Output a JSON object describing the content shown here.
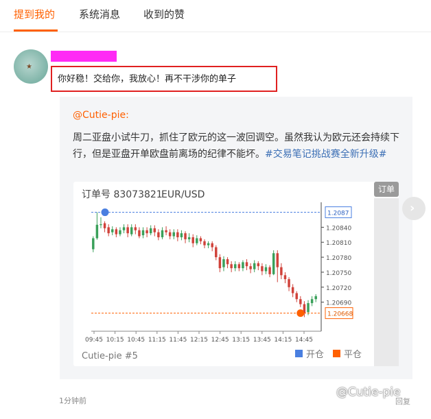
{
  "tabs": [
    {
      "label": "提到我的",
      "active": true
    },
    {
      "label": "系统消息",
      "active": false
    },
    {
      "label": "收到的赞",
      "active": false
    }
  ],
  "comment": {
    "text": "你好稳！交给你，我放心！再不干涉你的单子",
    "time": "1分钟前",
    "reply": "回复"
  },
  "quoted_post": {
    "mention": "@Cutie-pie:",
    "body": "周二亚盘小试牛刀，抓住了欧元的这一波回调空。虽然我认为欧元还会持续下行，但是亚盘开单欧盘前离场的纪律不能坏。",
    "hashtag": "#交易笔记挑战赛全新升级#"
  },
  "order_card": {
    "order_tag": "订单",
    "order_label": "订单号 83073821",
    "symbol": "EUR/USD",
    "author": "Cutie-pie #5",
    "legend_open": "开仓",
    "legend_close": "平仓",
    "open_color": "#4a7fe0",
    "close_color": "#ff6000"
  },
  "watermark": "@Cutie-pie",
  "chart_data": {
    "type": "candlestick",
    "x_ticks": [
      "09:45",
      "10:15",
      "10:45",
      "11:15",
      "11:45",
      "12:15",
      "12:45",
      "13:15",
      "13:45",
      "14:15",
      "14:45"
    ],
    "y_ticks": [
      "1.20840",
      "1.20810",
      "1.20780",
      "1.20750",
      "1.20720",
      "1.20690"
    ],
    "ylim": [
      1.2064,
      1.2089
    ],
    "open_price": "1.2087",
    "close_price": "1.20668",
    "open_level": 1.2087,
    "close_level": 1.20668,
    "candles": [
      [
        1.20796,
        1.20818,
        1.2079,
        1.20822
      ],
      [
        1.20818,
        1.20845,
        1.20815,
        1.2087
      ],
      [
        1.20845,
        1.20846,
        1.20838,
        1.2086
      ],
      [
        1.20848,
        1.20838,
        1.2083,
        1.20852
      ],
      [
        1.2084,
        1.20828,
        1.20822,
        1.20846
      ],
      [
        1.2083,
        1.20836,
        1.20824,
        1.20842
      ],
      [
        1.20836,
        1.20826,
        1.2082,
        1.2084
      ],
      [
        1.20826,
        1.20834,
        1.20822,
        1.2084
      ],
      [
        1.20834,
        1.2084,
        1.20828,
        1.20846
      ],
      [
        1.2084,
        1.20828,
        1.2082,
        1.20846
      ],
      [
        1.20826,
        1.2084,
        1.20822,
        1.20846
      ],
      [
        1.2084,
        1.20834,
        1.20826,
        1.20846
      ],
      [
        1.20834,
        1.20822,
        1.20818,
        1.2084
      ],
      [
        1.20824,
        1.20834,
        1.20818,
        1.2084
      ],
      [
        1.20834,
        1.20828,
        1.2082,
        1.2084
      ],
      [
        1.20828,
        1.20838,
        1.20824,
        1.20844
      ],
      [
        1.20838,
        1.2083,
        1.20822,
        1.20844
      ],
      [
        1.2083,
        1.2082,
        1.20814,
        1.20836
      ],
      [
        1.2082,
        1.20834,
        1.20816,
        1.2084
      ],
      [
        1.20834,
        1.2083,
        1.20824,
        1.20842
      ],
      [
        1.2083,
        1.20822,
        1.20816,
        1.20836
      ],
      [
        1.20822,
        1.2083,
        1.20816,
        1.20836
      ],
      [
        1.2083,
        1.2082,
        1.20812,
        1.20836
      ],
      [
        1.2082,
        1.20828,
        1.20814,
        1.20834
      ],
      [
        1.20828,
        1.20816,
        1.20808,
        1.20832
      ],
      [
        1.20816,
        1.2082,
        1.2081,
        1.20828
      ],
      [
        1.2082,
        1.20808,
        1.208,
        1.20826
      ],
      [
        1.20808,
        1.20818,
        1.20804,
        1.20824
      ],
      [
        1.20818,
        1.20812,
        1.20806,
        1.20822
      ],
      [
        1.20812,
        1.20804,
        1.20798,
        1.20816
      ],
      [
        1.20804,
        1.20808,
        1.20798,
        1.20812
      ],
      [
        1.20808,
        1.208,
        1.20792,
        1.20812
      ],
      [
        1.208,
        1.2078,
        1.20774,
        1.20804
      ],
      [
        1.2078,
        1.20758,
        1.2075,
        1.20786
      ],
      [
        1.2076,
        1.20776,
        1.20752,
        1.20782
      ],
      [
        1.20776,
        1.20766,
        1.20758,
        1.2078
      ],
      [
        1.20766,
        1.20758,
        1.2075,
        1.20772
      ],
      [
        1.20758,
        1.20766,
        1.20752,
        1.20772
      ],
      [
        1.20766,
        1.20758,
        1.20752,
        1.2077
      ],
      [
        1.20758,
        1.2077,
        1.20752,
        1.20774
      ],
      [
        1.2077,
        1.20762,
        1.20754,
        1.20776
      ],
      [
        1.20762,
        1.20756,
        1.20748,
        1.20768
      ],
      [
        1.20756,
        1.20768,
        1.2075,
        1.20774
      ],
      [
        1.20768,
        1.20762,
        1.20754,
        1.20772
      ],
      [
        1.20762,
        1.20752,
        1.20744,
        1.20768
      ],
      [
        1.20752,
        1.2076,
        1.20746,
        1.20766
      ],
      [
        1.2076,
        1.20746,
        1.2074,
        1.20764
      ],
      [
        1.20746,
        1.20788,
        1.20744,
        1.20794
      ],
      [
        1.20788,
        1.2076,
        1.2073,
        1.20794
      ],
      [
        1.2076,
        1.20744,
        1.20736,
        1.20768
      ],
      [
        1.20744,
        1.20736,
        1.20728,
        1.2075
      ],
      [
        1.20736,
        1.2072,
        1.20712,
        1.2074
      ],
      [
        1.2072,
        1.20708,
        1.207,
        1.20726
      ],
      [
        1.20708,
        1.20696,
        1.2069,
        1.20712
      ],
      [
        1.20696,
        1.20686,
        1.2068,
        1.20702
      ],
      [
        1.20686,
        1.20668,
        1.2066,
        1.20692
      ],
      [
        1.2067,
        1.20688,
        1.20664,
        1.20694
      ],
      [
        1.20688,
        1.20696,
        1.20682,
        1.20702
      ],
      [
        1.20696,
        1.20702,
        1.2069,
        1.20706
      ]
    ]
  }
}
